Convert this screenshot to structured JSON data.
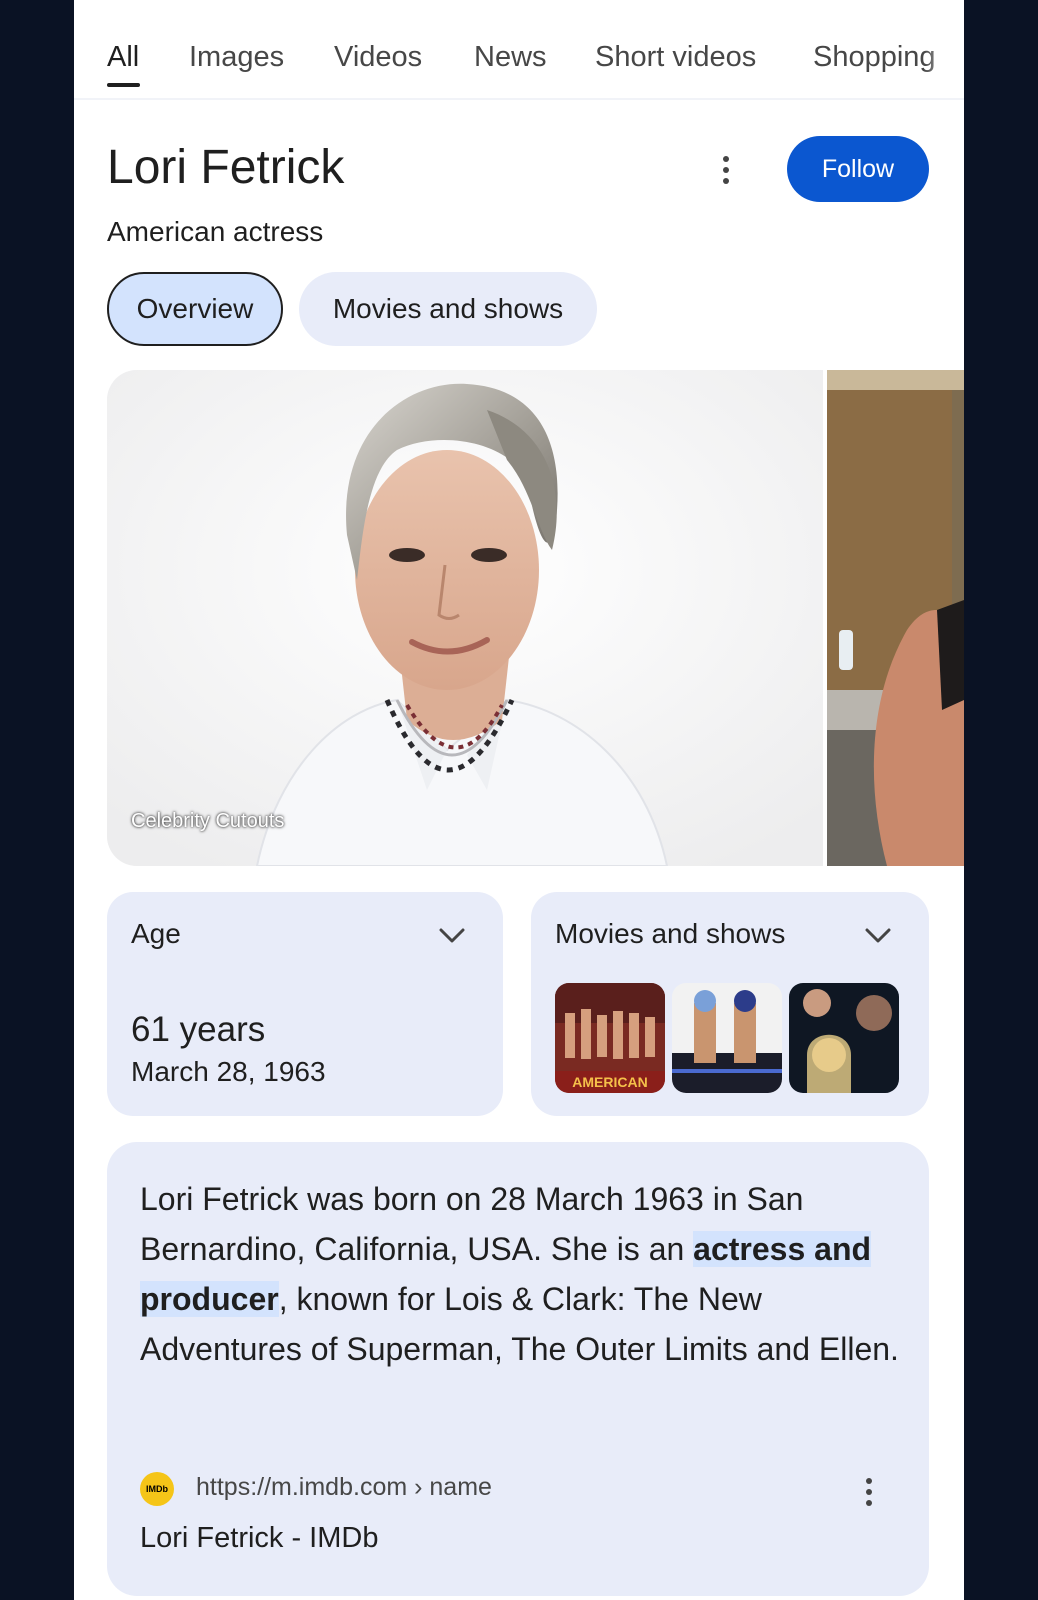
{
  "tabs": [
    "All",
    "Images",
    "Videos",
    "News",
    "Short videos",
    "Shopping"
  ],
  "entity": {
    "name": "Lori Fetrick",
    "description": "American actress",
    "follow_label": "Follow"
  },
  "chips": {
    "overview": "Overview",
    "movies": "Movies and shows"
  },
  "image": {
    "caption": "Celebrity Cutouts"
  },
  "age_card": {
    "heading": "Age",
    "value": "61 years",
    "date": "March 28, 1963"
  },
  "movies_card": {
    "heading": "Movies and shows",
    "thumb1_text": "AMERICAN"
  },
  "about": {
    "text_pre": "Lori Fetrick was born on 28 March 1963 in San Bernardino, California, USA. She is an ",
    "text_highlight": "actress and producer",
    "text_post": ", known for Lois & Clark: The New Adventures of Superman, The Outer Limits and Ellen.",
    "source_icon": "IMDb",
    "source_url": "https://m.imdb.com › name",
    "source_title": "Lori Fetrick - IMDb"
  },
  "colors": {
    "accent": "#0b57d0",
    "chip_selected": "#d3e3fd",
    "card_bg": "#e8ecf9",
    "background": "#0a1224"
  }
}
